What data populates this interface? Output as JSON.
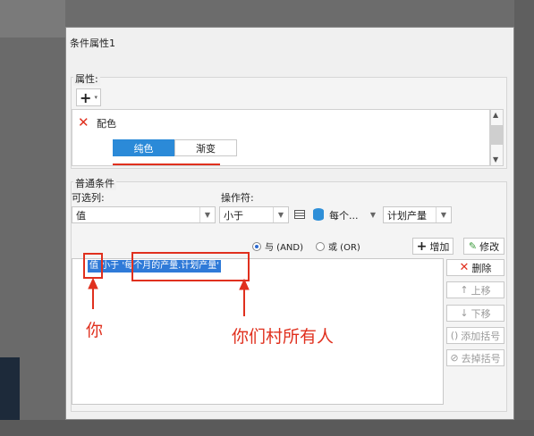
{
  "dialog": {
    "title": "条件属性1",
    "attributes": {
      "section_label": "属性:",
      "add_symbol": "+",
      "item_label": "配色",
      "tabs": [
        "纯色",
        "渐变"
      ],
      "accent": "#2b8ad8"
    },
    "conditions": {
      "section_label": "普通条件",
      "column_label": "可选列:",
      "operator_label": "操作符:",
      "column_value": "值",
      "operator_value": "小于",
      "field_value": "每个...",
      "field2_value": "计划产量",
      "radio_and": "与 (AND)",
      "radio_or": "或 (OR)",
      "add_label": "增加",
      "modify_label": "修改",
      "delete_label": "删除",
      "up_label": "上移",
      "down_label": "下移",
      "add_bracket_label": "添加括号",
      "remove_bracket_label": "去掉括号",
      "condition_text": "值 小于 '每个月的产量.计划产量'"
    },
    "annotations": {
      "left_text": "你",
      "right_text": "你们村所有人",
      "color": "#e0301e"
    }
  }
}
